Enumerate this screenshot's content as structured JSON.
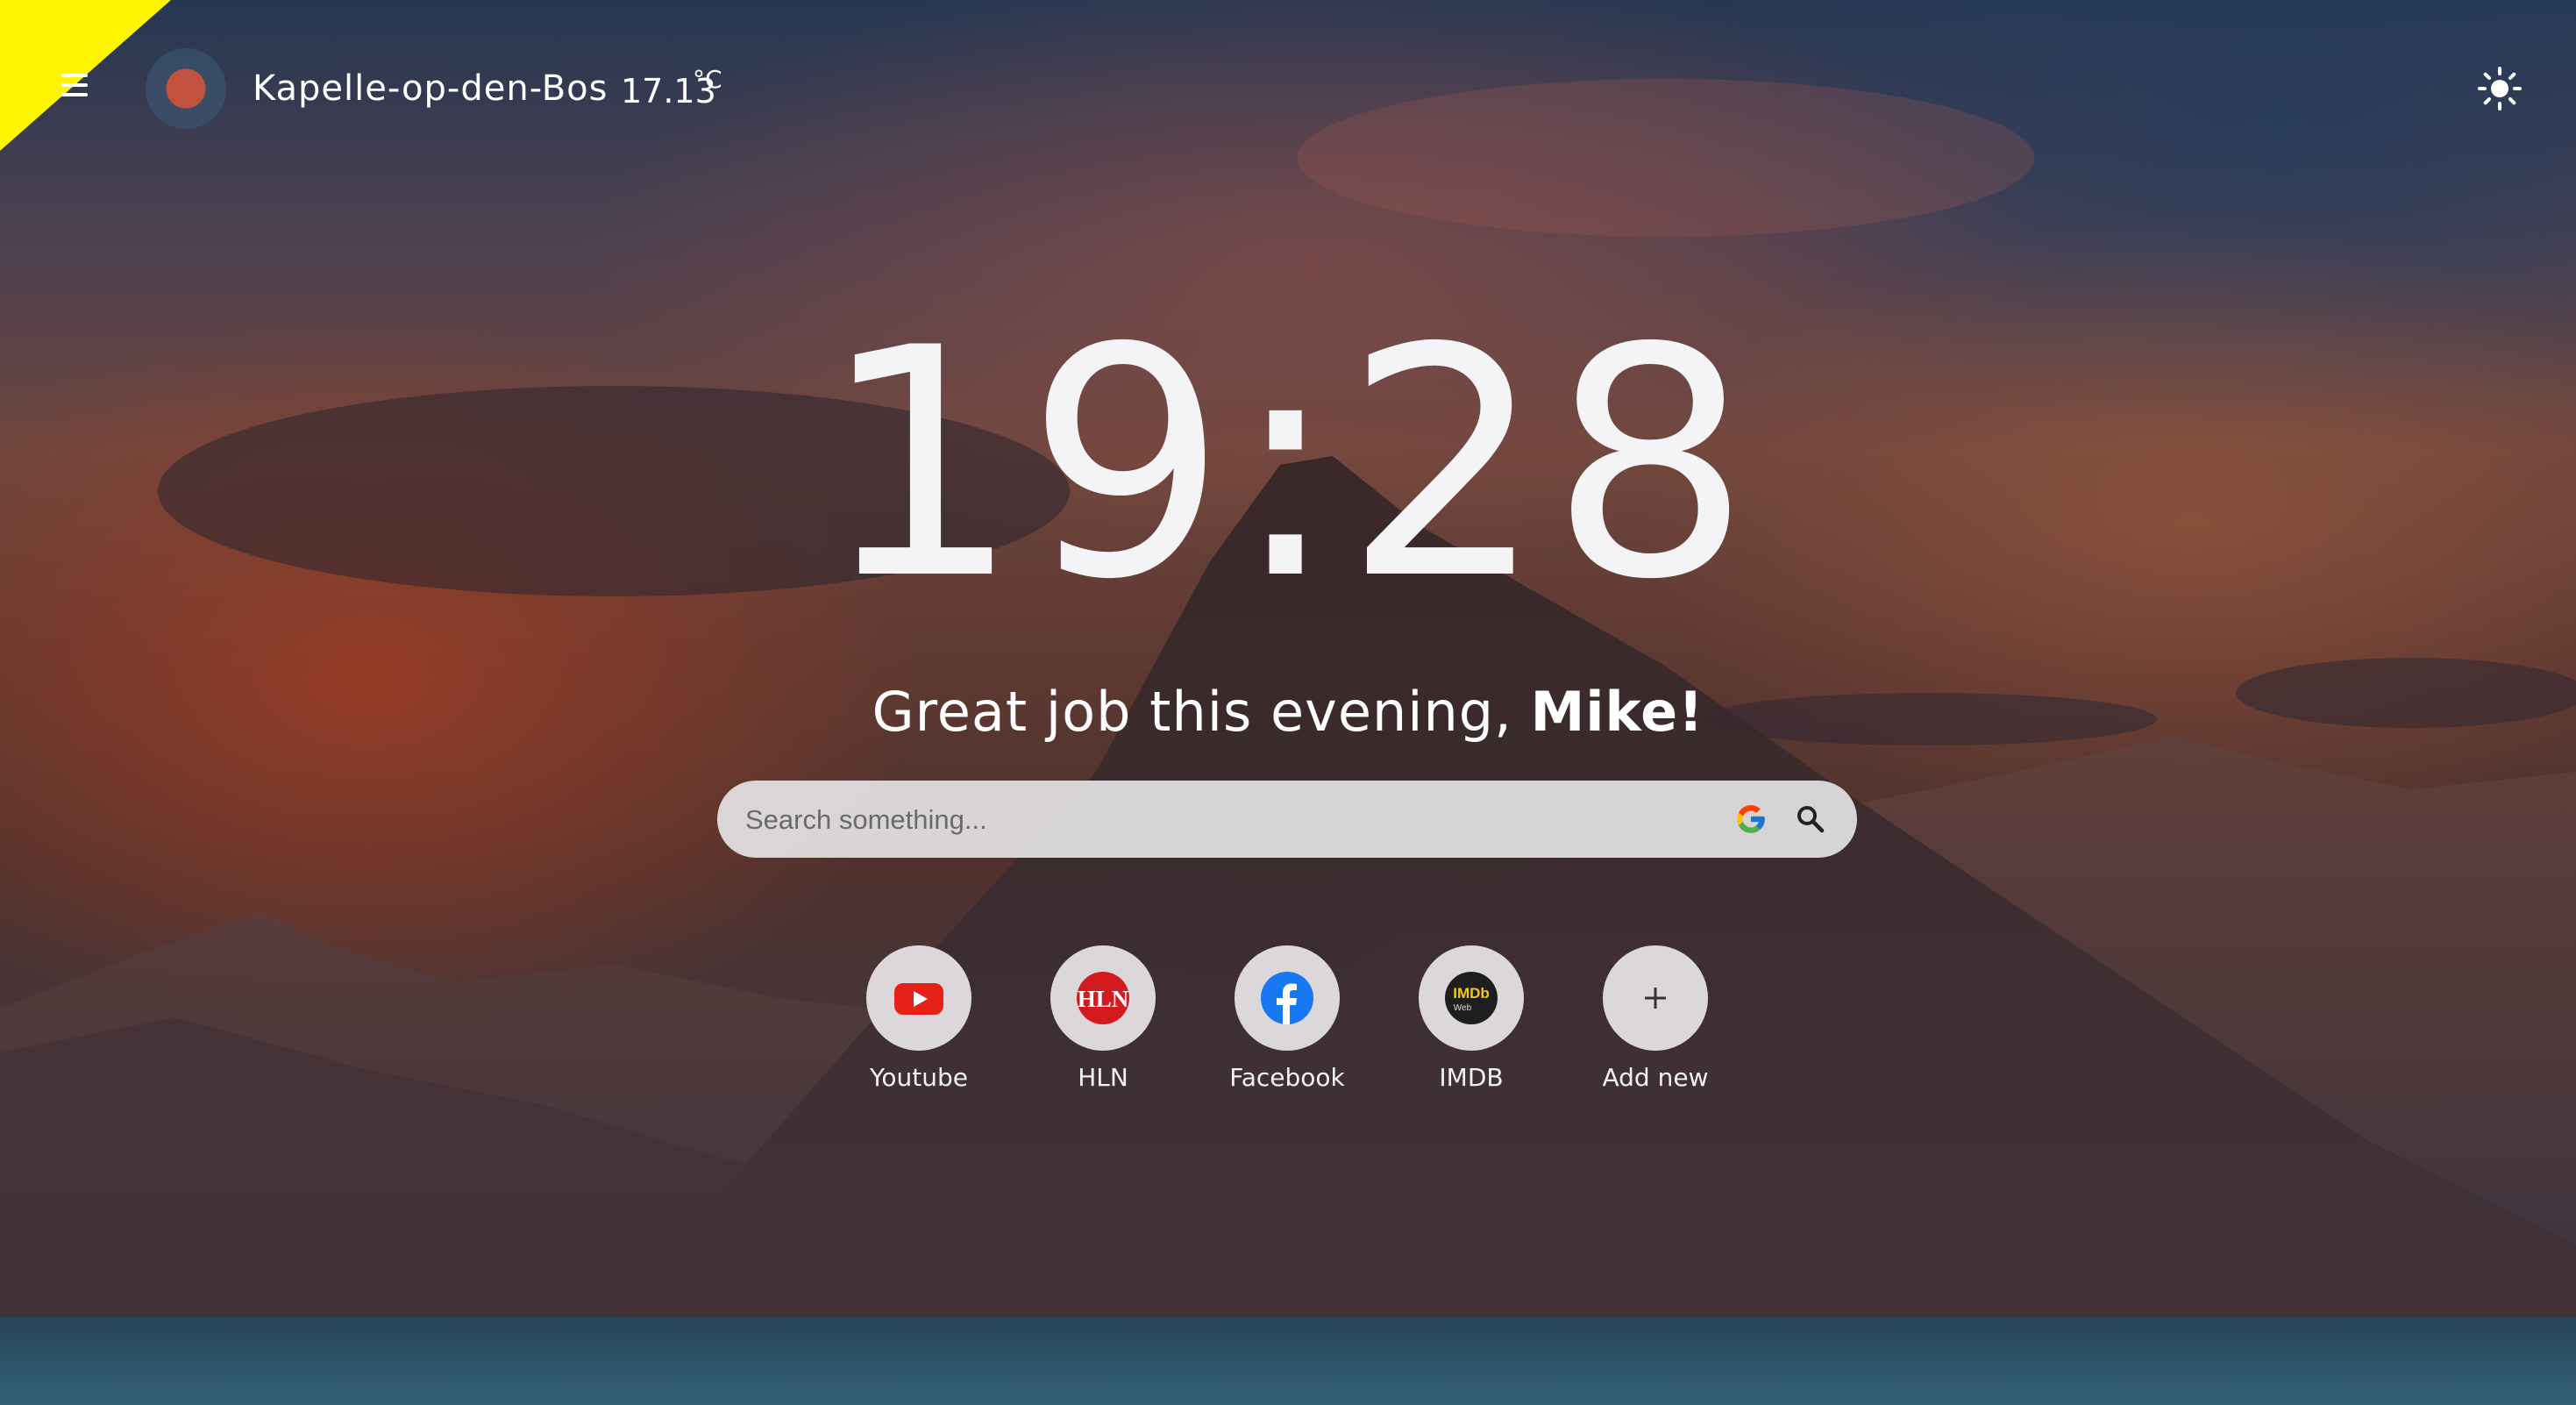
{
  "header": {
    "location": "Kapelle-op-den-Bos",
    "temperature": "17.13",
    "temperature_unit": "°C"
  },
  "clock": {
    "time": "19:28"
  },
  "greeting": {
    "text": "Great job this evening, ",
    "name": "Mike!"
  },
  "search": {
    "placeholder": "Search something...",
    "value": ""
  },
  "shortcuts": [
    {
      "label": "Youtube",
      "icon": "youtube-icon"
    },
    {
      "label": "HLN",
      "icon": "hln-icon"
    },
    {
      "label": "Facebook",
      "icon": "facebook-icon"
    },
    {
      "label": "IMDB",
      "icon": "imdb-icon"
    },
    {
      "label": "Add new",
      "icon": "plus-icon"
    }
  ],
  "icons": {
    "menu": "menu-icon",
    "weather": "weather-icon",
    "theme": "sun-icon",
    "google": "google-icon",
    "search": "search-icon"
  },
  "colors": {
    "corner_flag": "#fff500",
    "youtube_red": "#e62117",
    "hln_red": "#d21a1f",
    "facebook_blue": "#1877f2",
    "imdb_yellow": "#f5c518"
  }
}
